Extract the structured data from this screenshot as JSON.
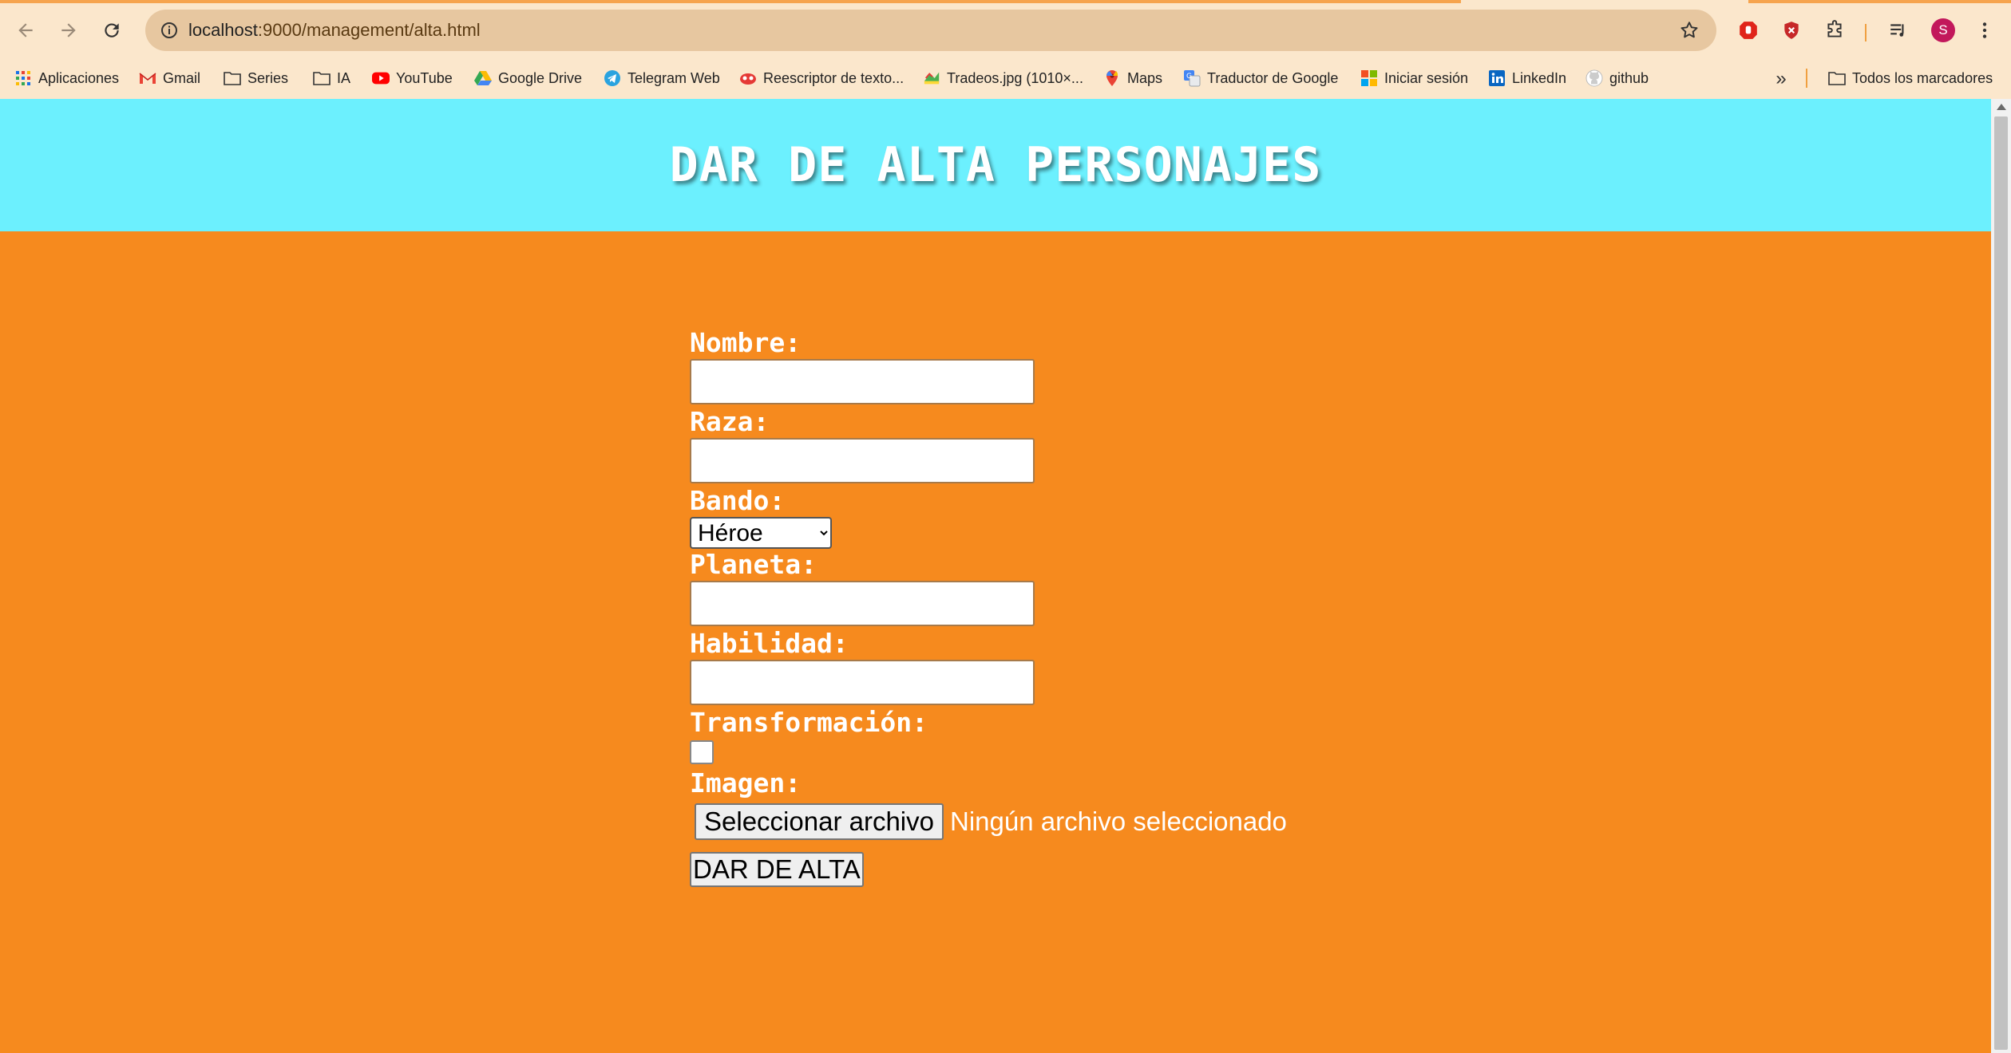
{
  "browser": {
    "url_host": "localhost",
    "url_rest": ":9000/management/alta.html",
    "profile_initial": "S",
    "bookmarks": [
      {
        "label": "Aplicaciones",
        "icon": "apps-grid-icon"
      },
      {
        "label": "Gmail",
        "icon": "gmail-icon"
      },
      {
        "label": "Series",
        "icon": "folder-icon"
      },
      {
        "label": "IA",
        "icon": "folder-icon"
      },
      {
        "label": "YouTube",
        "icon": "youtube-icon"
      },
      {
        "label": "Google Drive",
        "icon": "google-drive-icon"
      },
      {
        "label": "Telegram Web",
        "icon": "telegram-icon"
      },
      {
        "label": "Reescriptor de texto...",
        "icon": "rewriter-icon"
      },
      {
        "label": "Tradeos.jpg (1010×...",
        "icon": "image-icon"
      },
      {
        "label": "Maps",
        "icon": "maps-pin-icon"
      },
      {
        "label": "Traductor de Google",
        "icon": "translate-icon"
      },
      {
        "label": "Iniciar sesión",
        "icon": "microsoft-icon"
      },
      {
        "label": "LinkedIn",
        "icon": "linkedin-icon"
      },
      {
        "label": "github",
        "icon": "github-icon"
      }
    ],
    "all_bookmarks_label": "Todos los marcadores"
  },
  "page": {
    "title": "DAR DE ALTA PERSONAJES",
    "form": {
      "nombre_label": "Nombre:",
      "nombre_value": "",
      "raza_label": "Raza:",
      "raza_value": "",
      "bando_label": "Bando:",
      "bando_selected": "Héroe",
      "planeta_label": "Planeta:",
      "planeta_value": "",
      "habilidad_label": "Habilidad:",
      "habilidad_value": "",
      "transformacion_label": "Transformación:",
      "transformacion_checked": false,
      "imagen_label": "Imagen:",
      "file_button_label": "Seleccionar archivo",
      "file_status": "Ningún archivo seleccionado",
      "submit_label": "DAR DE ALTA"
    }
  },
  "colors": {
    "header_bg": "#6cf0fe",
    "page_bg": "#f68a1e",
    "chrome_bg": "#fbe7cc"
  }
}
